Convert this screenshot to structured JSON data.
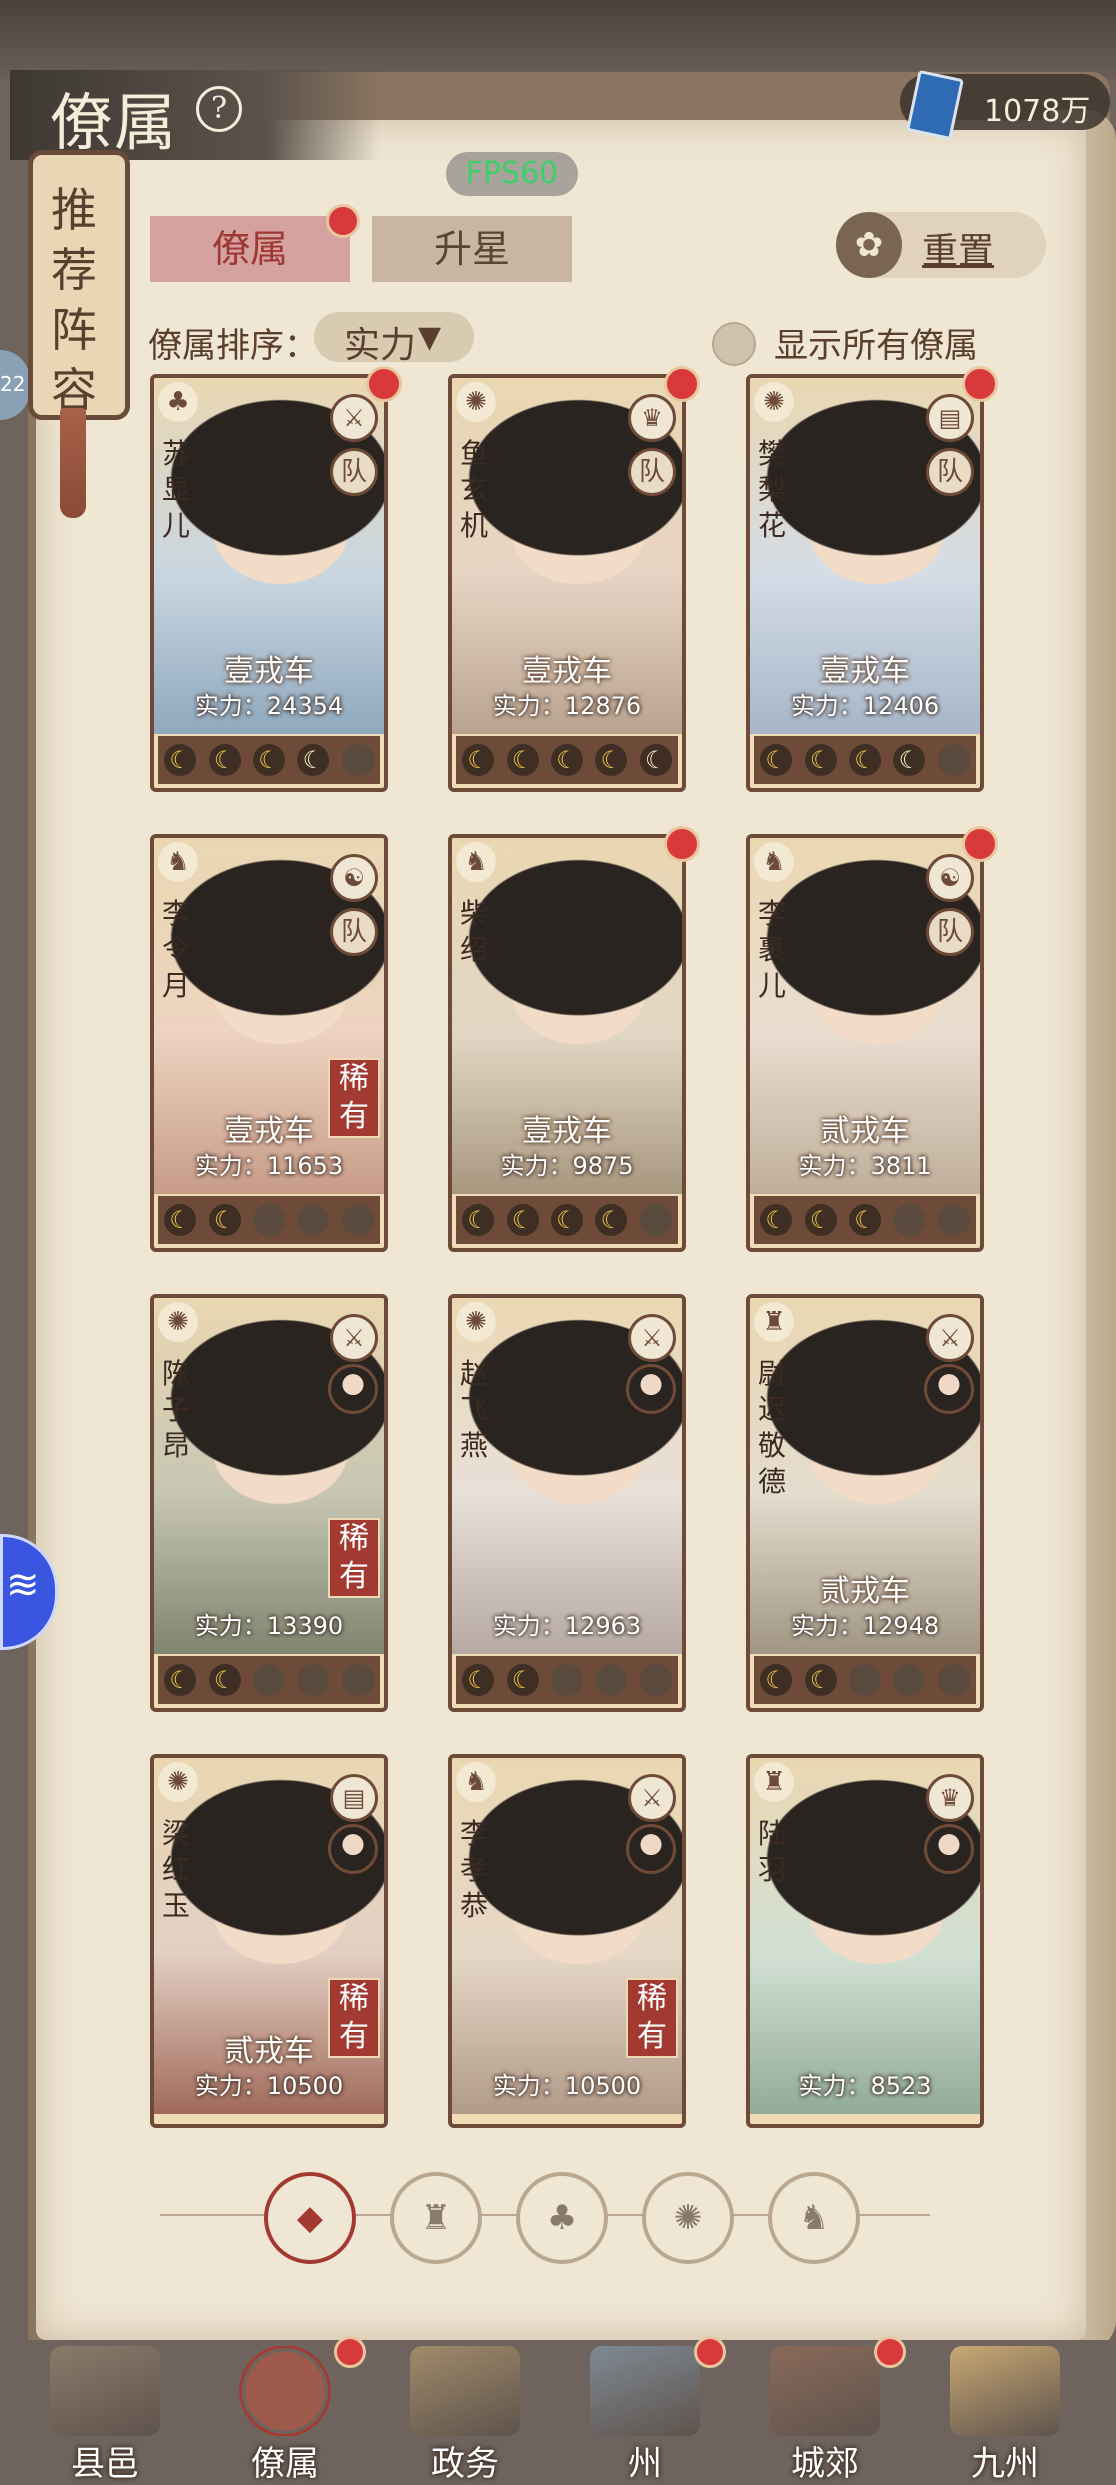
{
  "header": {
    "title": "僚属",
    "help_icon": "question-icon",
    "currency_icon": "book-icon",
    "currency_value": "1078万",
    "fps_badge": "FPS60",
    "left_badge": "22"
  },
  "recommend_tab": {
    "label": "推荐阵容"
  },
  "tabs": [
    {
      "label": "僚属",
      "active": true,
      "badge": true
    },
    {
      "label": "升星",
      "active": false,
      "badge": false
    }
  ],
  "reset": {
    "label": "重置",
    "icon": "reset-icon"
  },
  "sort": {
    "label": "僚属排序：",
    "value": "实力"
  },
  "show_all": {
    "label": "显示所有僚属",
    "checked": false
  },
  "cards": [
    {
      "name": "苏显儿",
      "faction_icon": "gourd-icon",
      "type_icon": "sword-icon",
      "team": "队",
      "rank": "壹戎车",
      "power": "实力：24354",
      "rare": "",
      "moons": [
        2,
        2,
        2,
        1,
        0
      ],
      "dot": true
    },
    {
      "name": "鱼玄机",
      "faction_icon": "fan-icon",
      "type_icon": "hat-icon",
      "team": "队",
      "rank": "壹戎车",
      "power": "实力：12876",
      "rare": "",
      "moons": [
        2,
        2,
        2,
        2,
        1
      ],
      "dot": true
    },
    {
      "name": "樊梨花",
      "faction_icon": "fan-icon",
      "type_icon": "book-icon",
      "team": "队",
      "rank": "壹戎车",
      "power": "实力：12406",
      "rare": "",
      "moons": [
        2,
        2,
        2,
        1,
        0
      ],
      "dot": true
    },
    {
      "name": "李令月",
      "faction_icon": "lion-icon",
      "type_icon": "yinyang-icon",
      "team": "队",
      "rank": "壹戎车",
      "power": "实力：11653",
      "rare": "稀有",
      "moons": [
        2,
        2,
        0,
        0,
        0
      ],
      "dot": false
    },
    {
      "name": "柴绍",
      "faction_icon": "lion-icon",
      "type_icon": "",
      "team": "",
      "rank": "壹戎车",
      "power": "实力：9875",
      "rare": "",
      "moons": [
        2,
        2,
        2,
        2,
        0
      ],
      "dot": true
    },
    {
      "name": "李裹儿",
      "faction_icon": "lion-icon",
      "type_icon": "yinyang-icon",
      "team": "队",
      "rank": "贰戎车",
      "power": "实力：3811",
      "rare": "",
      "moons": [
        2,
        2,
        2,
        0,
        0
      ],
      "dot": true
    },
    {
      "name": "陈子昂",
      "faction_icon": "fan-icon",
      "type_icon": "sword-icon",
      "team": "",
      "rank": "",
      "power": "实力：13390",
      "rare": "稀有",
      "moons": [
        2,
        2,
        0,
        0,
        0
      ],
      "dot": false
    },
    {
      "name": "赵飞燕",
      "faction_icon": "fan-icon",
      "type_icon": "sword-icon",
      "team": "",
      "rank": "",
      "power": "实力：12963",
      "rare": "",
      "moons": [
        2,
        2,
        0,
        0,
        0
      ],
      "dot": false
    },
    {
      "name": "尉迟敬德",
      "faction_icon": "bell-icon",
      "type_icon": "sword-icon",
      "team": "",
      "rank": "贰戎车",
      "power": "实力：12948",
      "rare": "",
      "moons": [
        2,
        2,
        0,
        0,
        0
      ],
      "dot": false
    },
    {
      "name": "梁红玉",
      "faction_icon": "fan-icon",
      "type_icon": "book-icon",
      "team": "",
      "rank": "贰戎车",
      "power": "实力：10500",
      "rare": "稀有",
      "moons": [],
      "dot": false
    },
    {
      "name": "李孝恭",
      "faction_icon": "lion-icon",
      "type_icon": "sword-icon",
      "team": "",
      "rank": "",
      "power": "实力：10500",
      "rare": "稀有",
      "moons": [],
      "dot": false
    },
    {
      "name": "陆羽",
      "faction_icon": "bell-icon",
      "type_icon": "hat-icon",
      "team": "",
      "rank": "",
      "power": "实力：8523",
      "rare": "",
      "moons": [],
      "dot": false
    }
  ],
  "filters": [
    {
      "icon": "all-icon",
      "glyph": "◆",
      "active": true
    },
    {
      "icon": "bell-icon",
      "glyph": "♜",
      "active": false
    },
    {
      "icon": "gourd-icon",
      "glyph": "♣",
      "active": false
    },
    {
      "icon": "fan-icon",
      "glyph": "✺",
      "active": false
    },
    {
      "icon": "lion-icon",
      "glyph": "♞",
      "active": false
    }
  ],
  "nav": [
    {
      "label": "县邑",
      "dot": false,
      "active": false
    },
    {
      "label": "僚属",
      "dot": true,
      "active": true
    },
    {
      "label": "政务",
      "dot": false,
      "active": false
    },
    {
      "label": "州",
      "dot": true,
      "active": false
    },
    {
      "label": "城郊",
      "dot": true,
      "active": false
    },
    {
      "label": "九州",
      "dot": false,
      "active": false
    }
  ],
  "colors": {
    "accent_red": "#a23a32",
    "paper": "#efe6d3",
    "frame_brown": "#6e4a38",
    "fps_green": "#3fcf6a"
  }
}
